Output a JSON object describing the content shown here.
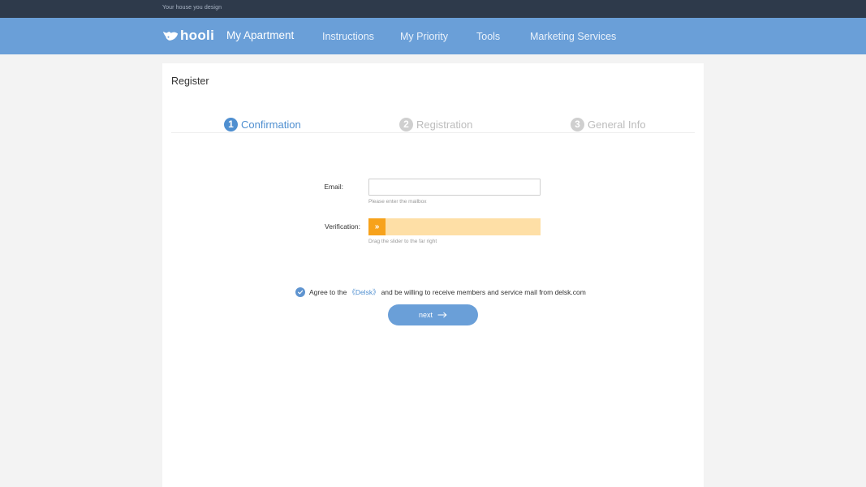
{
  "topbar": {
    "tagline": "Your house you design"
  },
  "navbar": {
    "brand": "hooli",
    "items": [
      {
        "label": "My Apartment"
      },
      {
        "label": "Instructions"
      },
      {
        "label": "My Priority"
      },
      {
        "label": "Tools"
      },
      {
        "label": "Marketing Services"
      }
    ]
  },
  "page": {
    "title": "Register"
  },
  "steps": [
    {
      "number": "1",
      "label": "Confirmation",
      "active": true
    },
    {
      "number": "2",
      "label": "Registration",
      "active": false
    },
    {
      "number": "3",
      "label": "General Info",
      "active": false
    }
  ],
  "form": {
    "email": {
      "label": "Email:",
      "value": "",
      "placeholder": "",
      "hint": "Please enter the mailbox"
    },
    "verification": {
      "label": "Verification:",
      "handle_glyph": "»",
      "hint": "Drag the slider to the far right"
    },
    "agree": {
      "prefix": "Agree to the",
      "link": "《Delsk》",
      "suffix": "and be willing to receive members and service mail from delsk.com",
      "checked": true
    },
    "next_label": "next"
  },
  "colors": {
    "topbar": "#2e3a4b",
    "navbar": "#6a9fd8",
    "accent": "#4f8fd0",
    "slider_track": "#fedfa6",
    "slider_handle": "#f7a21b"
  }
}
